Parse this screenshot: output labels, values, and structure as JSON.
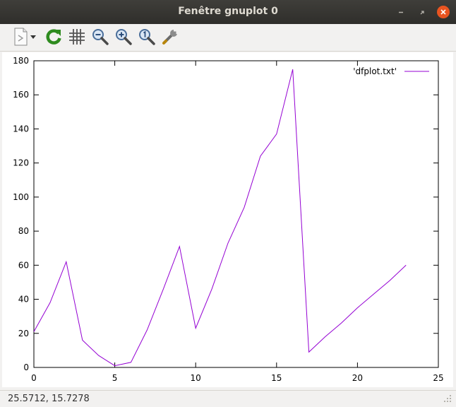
{
  "window": {
    "title": "Fenêtre gnuplot 0"
  },
  "toolbar": {
    "icons": [
      "export-icon",
      "dropdown-arrow-icon",
      "replot-icon",
      "grid-icon",
      "zoom-out-icon",
      "zoom-in-icon",
      "zoom-reset-icon",
      "config-icon"
    ]
  },
  "status": {
    "coords": "25.5712,  15.7278"
  },
  "chart_data": {
    "type": "line",
    "title": "",
    "xlabel": "",
    "ylabel": "",
    "xlim": [
      0,
      25
    ],
    "ylim": [
      0,
      180
    ],
    "xticks": [
      0,
      5,
      10,
      15,
      20,
      25
    ],
    "yticks": [
      0,
      20,
      40,
      60,
      80,
      100,
      120,
      140,
      160,
      180
    ],
    "grid": false,
    "legend": "top-right",
    "series": [
      {
        "name": "'dfplot.txt'",
        "color": "#9400d3",
        "x": [
          0,
          1,
          2,
          3,
          4,
          5,
          6,
          7,
          8,
          9,
          10,
          11,
          12,
          13,
          14,
          15,
          16,
          17,
          18,
          19,
          20,
          21,
          22,
          23
        ],
        "y": [
          21,
          38,
          62,
          16,
          7,
          1,
          3,
          22,
          46,
          71,
          23,
          46,
          73,
          94,
          124,
          137,
          175,
          9,
          18,
          26,
          35,
          43,
          51,
          60
        ]
      }
    ]
  }
}
